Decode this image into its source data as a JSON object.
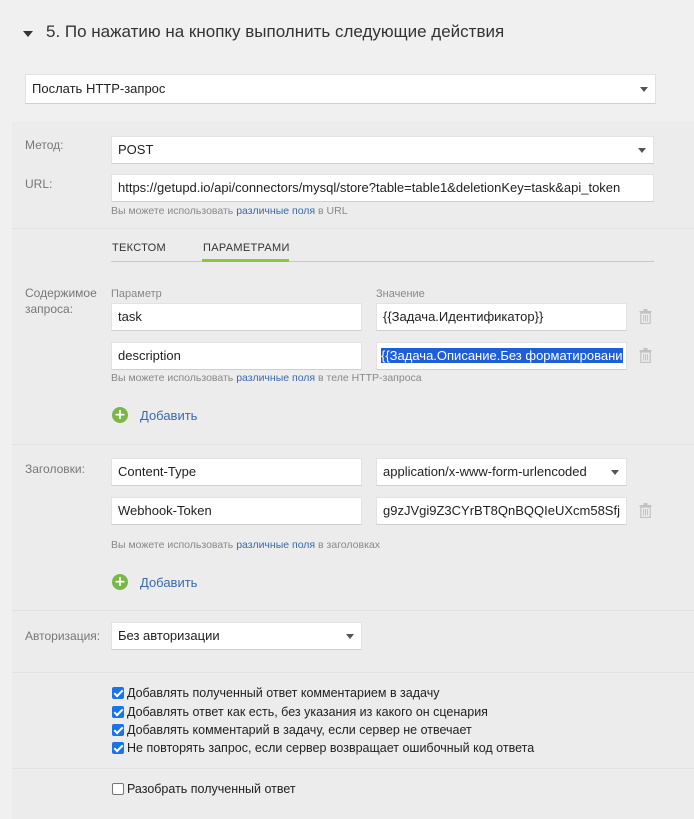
{
  "section": {
    "title": "5. По нажатию на кнопку выполнить следующие действия"
  },
  "action_select": {
    "value": "Послать HTTP-запрос"
  },
  "method": {
    "label": "Метод:",
    "value": "POST"
  },
  "url": {
    "label": "URL:",
    "value": "https://getupd.io/api/connectors/mysql/store?table=table1&deletionKey=task&api_token",
    "hint_prefix": "Вы можете использовать",
    "hint_link": "различные поля",
    "hint_suffix": "в URL"
  },
  "body": {
    "label": "Содержимое запроса:",
    "tabs": [
      "ТЕКСТОМ",
      "ПАРАМЕТРАМИ"
    ],
    "active_tab": "ПАРАМЕТРАМИ",
    "col_param": "Параметр",
    "col_value": "Значение",
    "rows": [
      {
        "param": "task",
        "value": "{{Задача.Идентификатор}}"
      },
      {
        "param": "description",
        "value": "{{Задача.Описание.Без форматировани"
      }
    ],
    "hint_prefix": "Вы можете использовать",
    "hint_link": "различные поля",
    "hint_suffix": "в теле HTTP-запроса",
    "add_label": "Добавить"
  },
  "headers": {
    "label": "Заголовки:",
    "rows": [
      {
        "name": "Content-Type",
        "value": "application/x-www-form-urlencoded"
      },
      {
        "name": "Webhook-Token",
        "value": "g9zJVgi9Z3CYrBT8QnBQQIeUXcm58Sfj"
      }
    ],
    "hint_prefix": "Вы можете использовать",
    "hint_link": "различные поля",
    "hint_suffix": "в заголовках",
    "add_label": "Добавить"
  },
  "auth": {
    "label": "Авторизация:",
    "value": "Без авторизации"
  },
  "options": [
    {
      "label": "Добавлять полученный ответ комментарием в задачу",
      "checked": true
    },
    {
      "label": "Добавлять ответ как есть, без указания из какого он сценария",
      "checked": true
    },
    {
      "label": "Добавлять комментарий в задачу, если сервер не отвечает",
      "checked": true
    },
    {
      "label": "Не повторять запрос, если сервер возвращает ошибочный код ответа",
      "checked": true
    }
  ],
  "parse_option": {
    "label": "Разобрать полученный ответ",
    "checked": false
  },
  "colors": {
    "accent_green": "#8cc63f",
    "link_blue": "#3a6aa8",
    "checkbox_blue": "#1a73e8",
    "selection_blue": "#1f5fd6"
  },
  "icons": [
    "caret-down-icon",
    "trash-icon",
    "plus-circle-icon",
    "checkbox-checked-icon",
    "checkbox-empty-icon"
  ]
}
